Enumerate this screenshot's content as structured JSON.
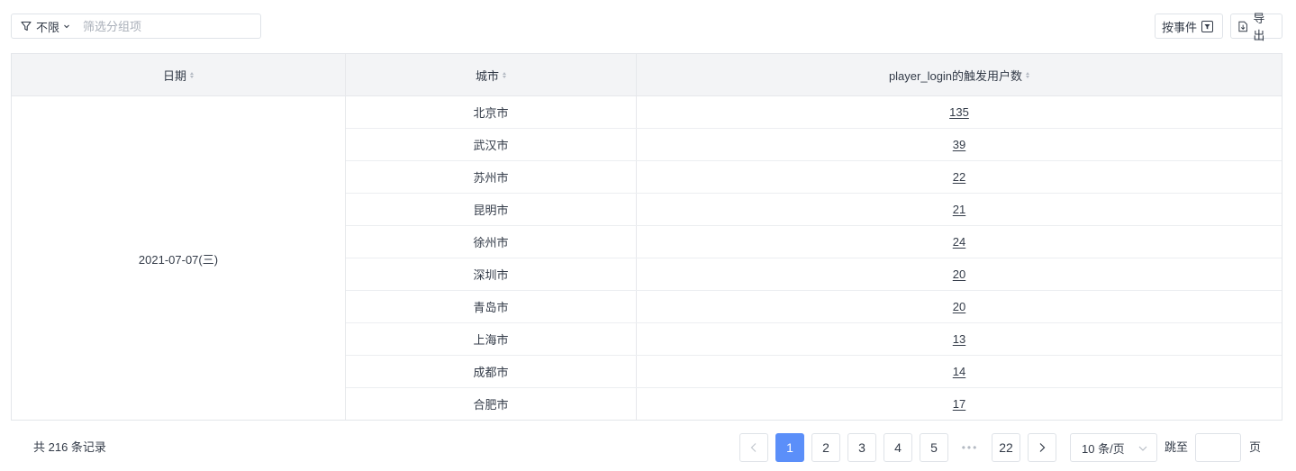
{
  "filter": {
    "selected": "不限",
    "placeholder": "筛选分组项"
  },
  "toolbar": {
    "by_event_label": "按事件",
    "export_label": "导出"
  },
  "table": {
    "columns": [
      "日期",
      "城市",
      "player_login的触发用户数"
    ],
    "date": "2021-07-07(三)",
    "rows": [
      {
        "city": "北京市",
        "count": "135"
      },
      {
        "city": "武汉市",
        "count": "39"
      },
      {
        "city": "苏州市",
        "count": "22"
      },
      {
        "city": "昆明市",
        "count": "21"
      },
      {
        "city": "徐州市",
        "count": "24"
      },
      {
        "city": "深圳市",
        "count": "20"
      },
      {
        "city": "青岛市",
        "count": "20"
      },
      {
        "city": "上海市",
        "count": "13"
      },
      {
        "city": "成都市",
        "count": "14"
      },
      {
        "city": "合肥市",
        "count": "17"
      }
    ]
  },
  "pagination": {
    "total_text": "共 216 条记录",
    "pages": [
      "1",
      "2",
      "3",
      "4",
      "5"
    ],
    "current_page": "1",
    "last_page": "22",
    "page_size": "10 条/页",
    "jump_label": "跳至",
    "jump_value": "",
    "page_unit": "页"
  },
  "colors": {
    "accent": "#5b8ff9",
    "header_bg": "#f3f4f6",
    "border": "#e3e6ea",
    "text": "#333b48"
  },
  "icons": [
    "filter-icon",
    "chevron-down-icon",
    "event-select-icon",
    "export-icon",
    "chevron-left-icon",
    "chevron-right-icon",
    "sort-icon"
  ]
}
